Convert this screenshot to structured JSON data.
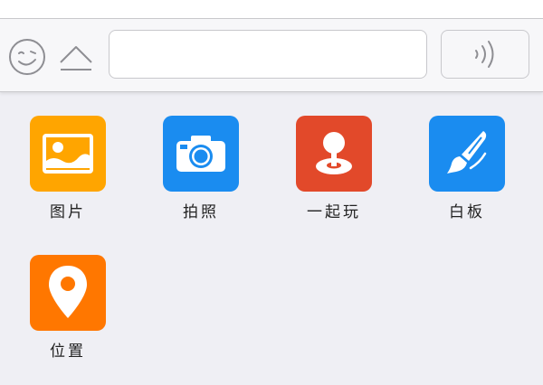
{
  "colors": {
    "background": "#efeff4",
    "toolbar": "#f7f7f9",
    "border": "#c8c8cc",
    "icon_gray": "#8e8e93"
  },
  "toolbar": {
    "emoji_icon": "smiley-face-icon",
    "more_icon": "eject-up-arrow-icon",
    "input_value": "",
    "voice_icon": "voice-waves-icon"
  },
  "apps": [
    {
      "label": "图片",
      "icon": "picture-icon",
      "color": "#ffa500"
    },
    {
      "label": "拍照",
      "icon": "camera-icon",
      "color": "#1a8cf0"
    },
    {
      "label": "一起玩",
      "icon": "joystick-icon",
      "color": "#e2492a"
    },
    {
      "label": "白板",
      "icon": "paintbrush-icon",
      "color": "#1a8cf0"
    },
    {
      "label": "位置",
      "icon": "location-pin-icon",
      "color": "#ff7700"
    }
  ]
}
